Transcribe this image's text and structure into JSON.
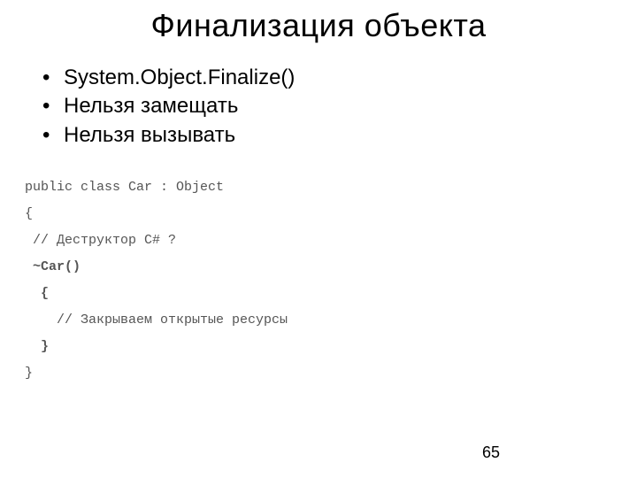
{
  "title": "Финализация объекта",
  "bullets": [
    "System.Object.Finalize()",
    "Нельзя замещать",
    "Нельзя вызывать"
  ],
  "code": {
    "line1": "public class Car : Object",
    "line2": "{",
    "line3": " // Деструктор С# ?",
    "line4": " ~Car()",
    "line5": "  {",
    "line6": "    // Закрываем открытые ресурсы",
    "line7": "  }",
    "line8": "}"
  },
  "page_number": "65"
}
